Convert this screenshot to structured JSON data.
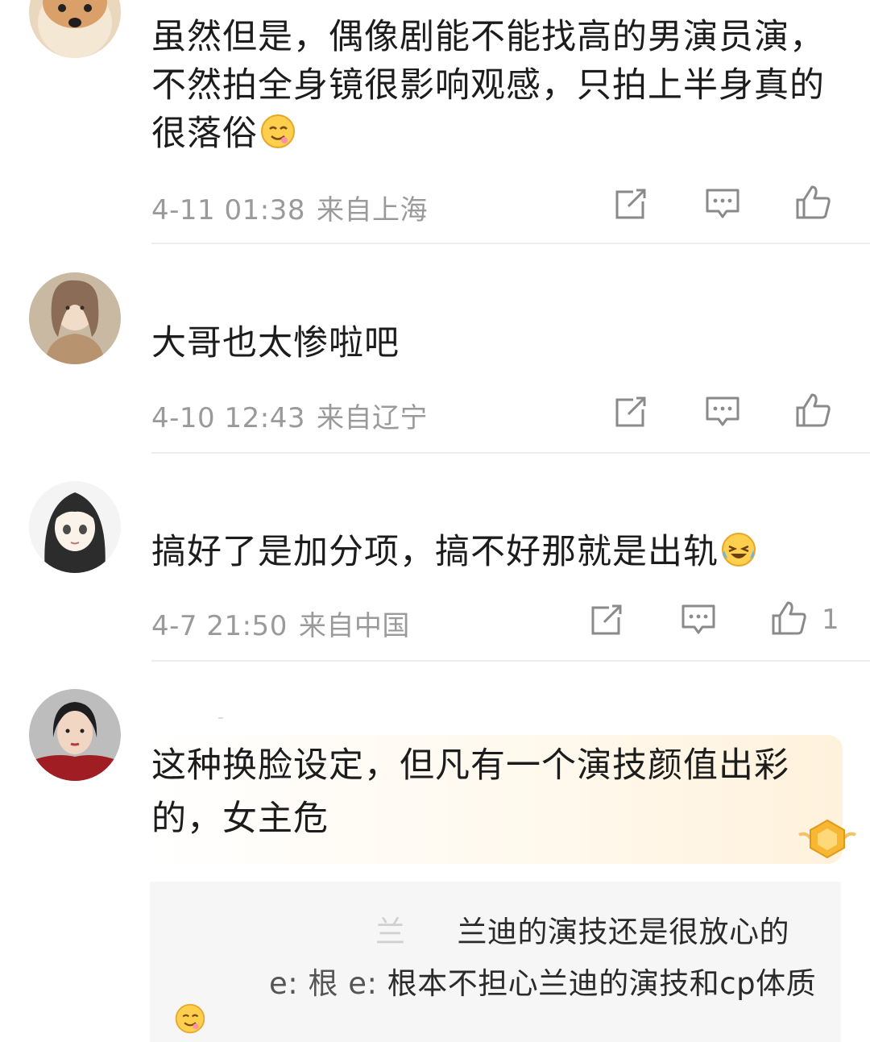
{
  "comments": [
    {
      "text_lines": [
        "虽然但是，偶像剧能不能找高的男演员演，",
        "不然拍全身镜很影响观感，只拍上半身真的",
        "很落俗"
      ],
      "emoji": "drooling-face-emoji",
      "time": "4-11 01:38",
      "location": "来自上海",
      "like_count": ""
    },
    {
      "text_lines": [
        "大哥也太惨啦吧"
      ],
      "time": "4-10 12:43",
      "location": "来自辽宁",
      "like_count": ""
    },
    {
      "text_lines": [
        "搞好了是加分项，搞不好那就是出轨"
      ],
      "emoji": "laughing-crying-emoji",
      "time": "4-7 21:50",
      "location": "来自中国",
      "like_count": "1"
    },
    {
      "text_lines": [
        "这种换脸设定，但凡有一个演技颜值出彩",
        "的，女主危"
      ]
    }
  ],
  "replies": [
    {
      "prefix": "兰",
      "text": "兰迪的演技还是很放心的"
    },
    {
      "prefix": "e: 根 e: ",
      "text": "根本不担心兰迪的演技和cp体质"
    }
  ],
  "icons": {
    "repost": "share-icon",
    "comment": "comment-icon",
    "like": "thumbs-up-icon"
  },
  "colors": {
    "meta": "#9a9a9a",
    "divider": "#ececec",
    "reply_bg": "#f6f6f6",
    "highlight": "#fff2dc"
  }
}
